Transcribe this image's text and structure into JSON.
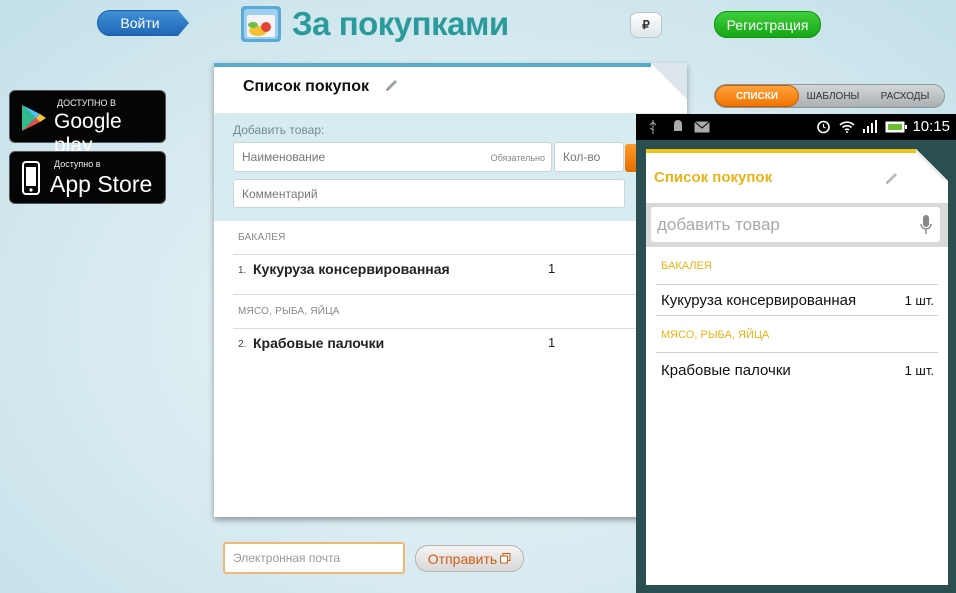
{
  "header": {
    "login_label": "Войти",
    "app_title": "За покупками",
    "currency_symbol": "₽",
    "register_label": "Регистрация"
  },
  "stores": {
    "google": {
      "small": "ДОСТУПНО В",
      "big": "Google play"
    },
    "apple": {
      "small": "Доступно в",
      "big": "App Store"
    }
  },
  "list": {
    "title": "Список покупок",
    "add_label": "Добавить товар:",
    "name_placeholder": "Наименование",
    "required_hint": "Обязательно",
    "qty_placeholder": "Кол-во",
    "comment_placeholder": "Комментарий",
    "categories": [
      {
        "name": "БАКАЛЕЯ",
        "items": [
          {
            "num": "1.",
            "name": "Кукуруза консервированная",
            "qty": "1"
          }
        ]
      },
      {
        "name": "МЯСО, РЫБА, ЯЙЦА",
        "items": [
          {
            "num": "2.",
            "name": "Крабовые палочки",
            "qty": "1"
          }
        ]
      }
    ]
  },
  "email": {
    "placeholder": "Электронная почта",
    "send_label": "Отправить"
  },
  "tabs": [
    "СПИСКИ",
    "ШАБЛОНЫ",
    "РАСХОДЫ"
  ],
  "active_tab": "СПИСКИ",
  "phone": {
    "time": "10:15",
    "title": "Список покупок",
    "search_placeholder": "добавить товар",
    "categories": [
      {
        "name": "БАКАЛЕЯ",
        "items": [
          {
            "name": "Кукуруза консервированная",
            "qty": "1 шт."
          }
        ]
      },
      {
        "name": "МЯСО, РЫБА, ЯЙЦА",
        "items": [
          {
            "name": "Крабовые палочки",
            "qty": "1 шт."
          }
        ]
      }
    ]
  },
  "colors": {
    "brand_teal": "#2a9a9a",
    "login_blue": "#1f68b6",
    "register_green": "#16a716",
    "accent_orange": "#f07400",
    "phone_accent": "#e8b417"
  }
}
